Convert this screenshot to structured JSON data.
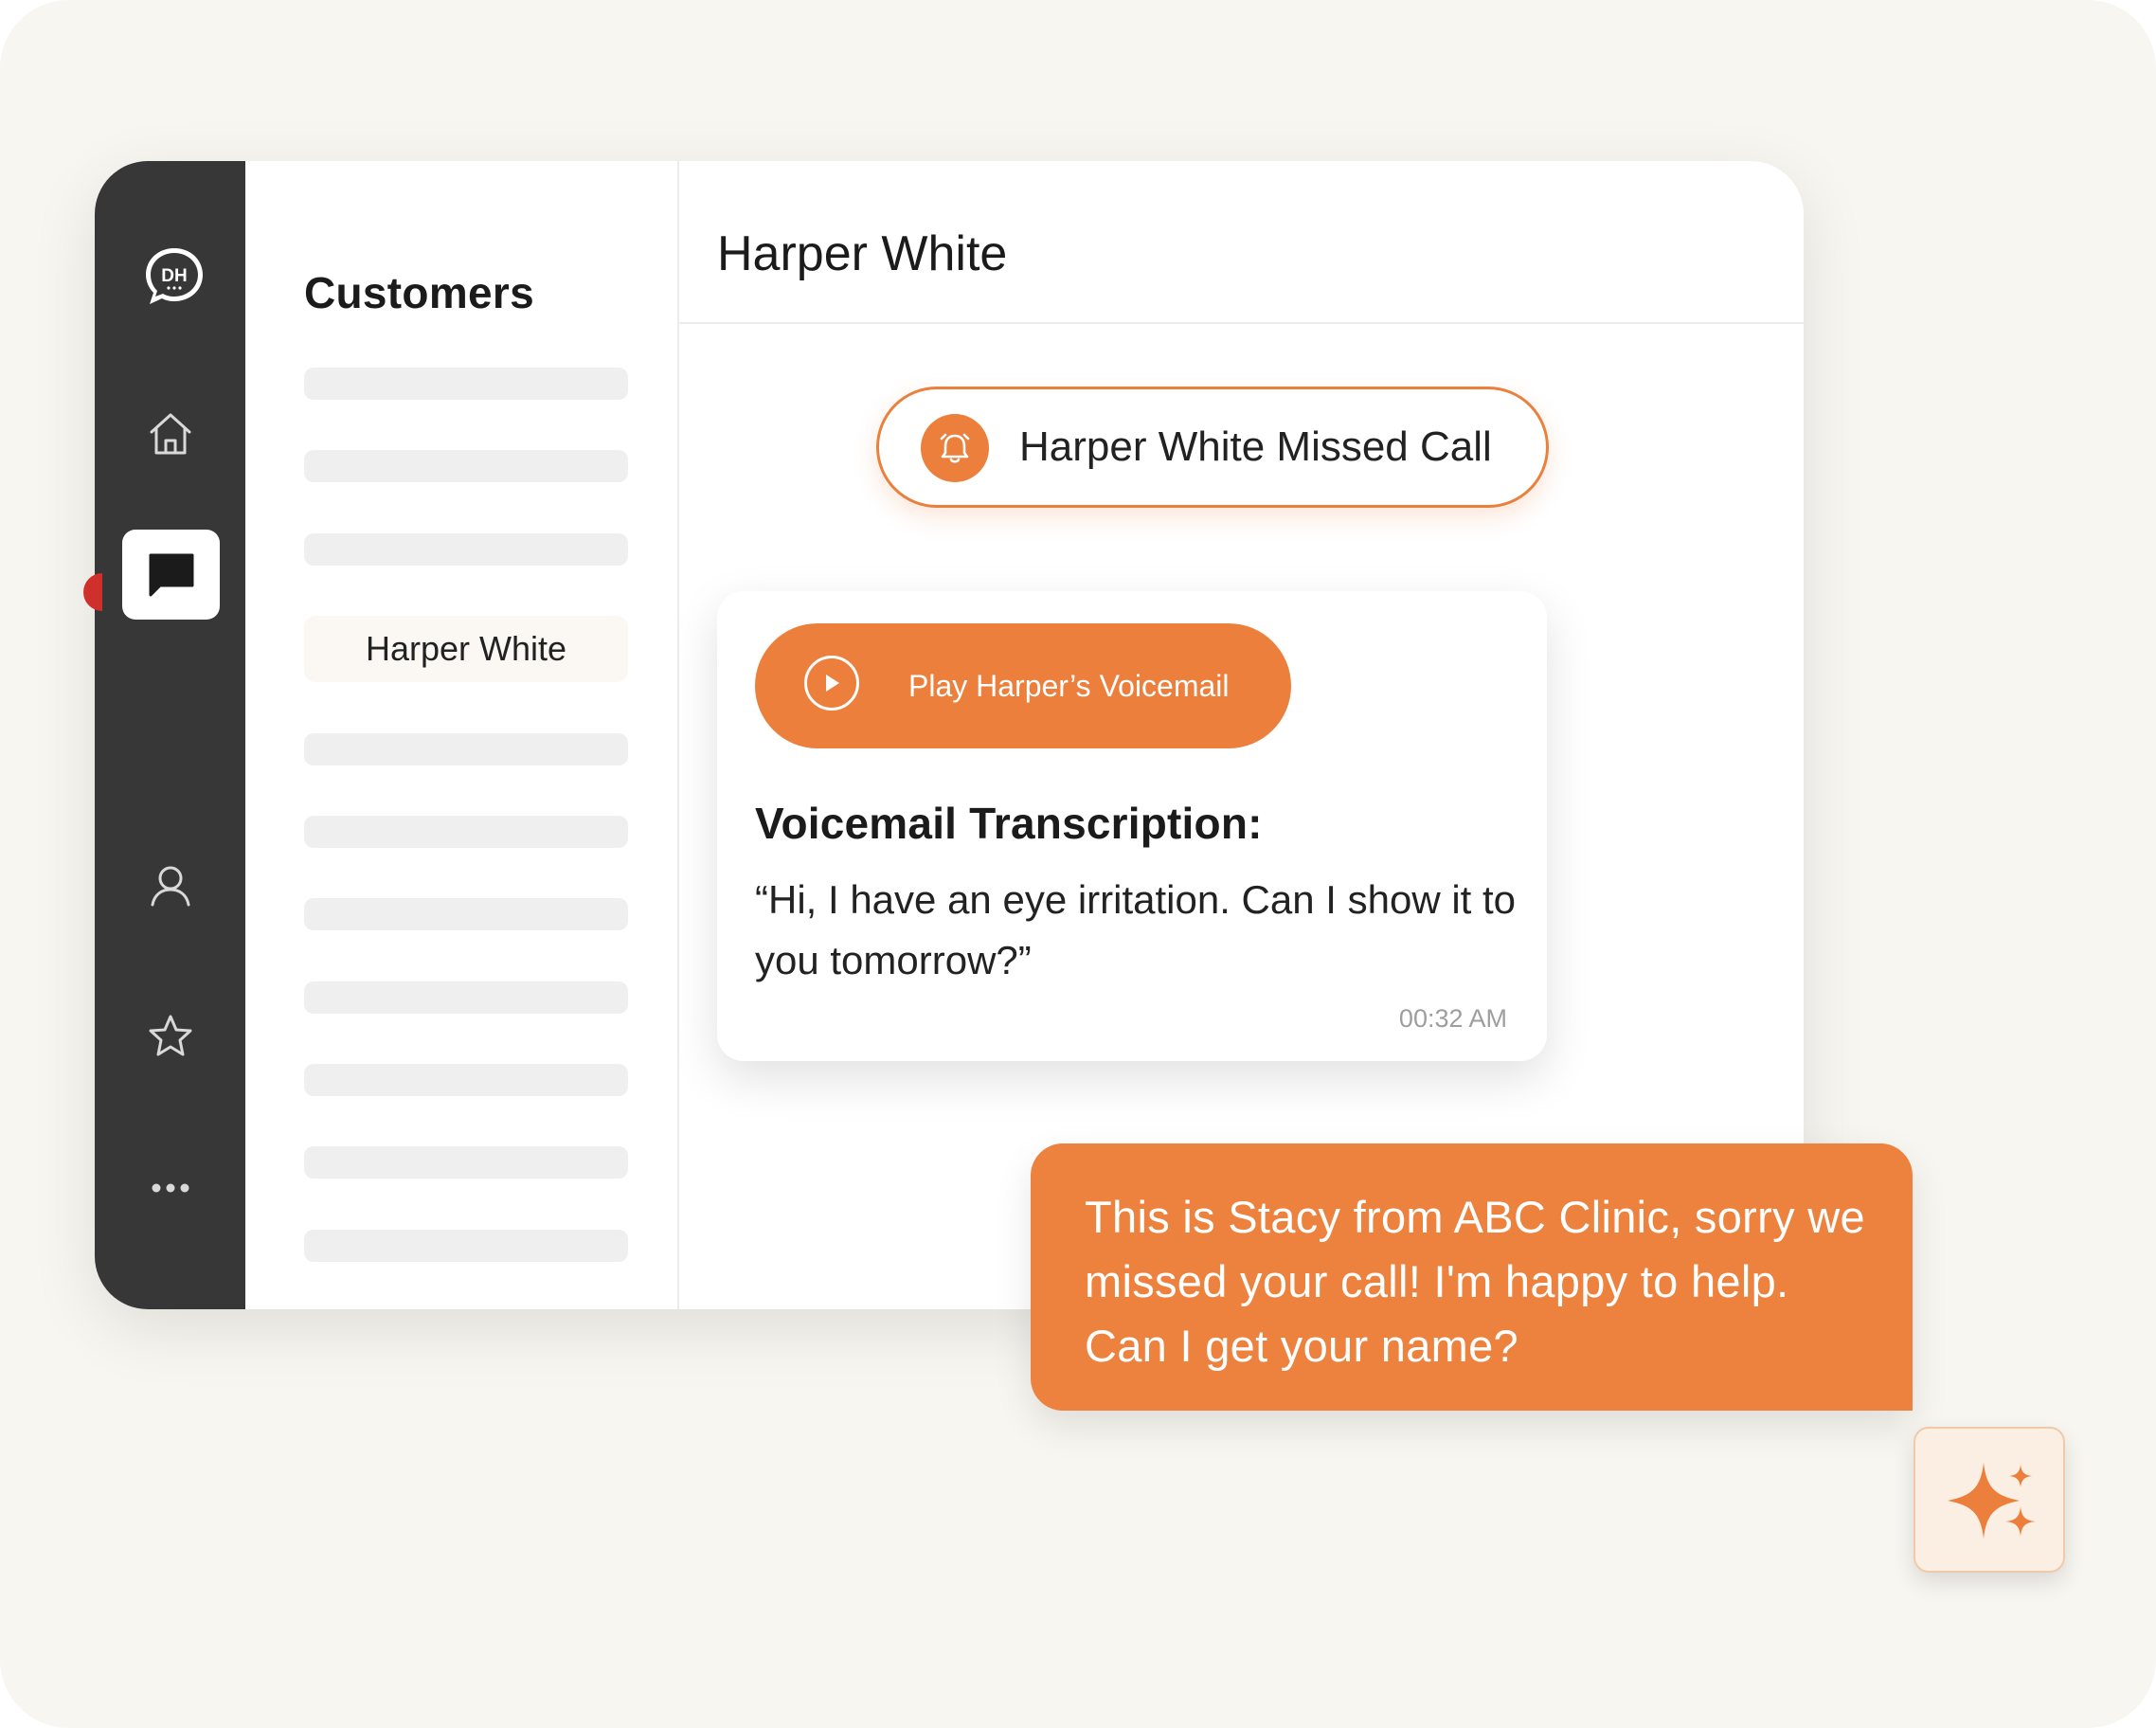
{
  "app": {
    "logo_text": "DH"
  },
  "rail": {
    "items": [
      {
        "icon": "home-icon"
      },
      {
        "icon": "chat-icon",
        "active": true
      },
      {
        "icon": "user-icon"
      },
      {
        "icon": "star-icon"
      },
      {
        "icon": "more-icon"
      }
    ]
  },
  "customers": {
    "title": "Customers",
    "selected_name": "Harper White"
  },
  "conversation": {
    "title": "Harper White",
    "missed_call_label": "Harper White Missed Call",
    "play_label": "Play Harper’s Voicemail",
    "transcription_heading": "Voicemail Transcription:",
    "transcription_text": "“Hi, I have an eye irritation. Can I show it to you tomorrow?”",
    "timestamp": "00:32 AM"
  },
  "reply": {
    "text": "This is Stacy from ABC Clinic, sorry we missed your call! I'm happy to help. Can I get your name?"
  },
  "colors": {
    "accent": "#ec7f3c",
    "rail_bg": "#373737",
    "canvas_bg": "#f7f6f1"
  }
}
